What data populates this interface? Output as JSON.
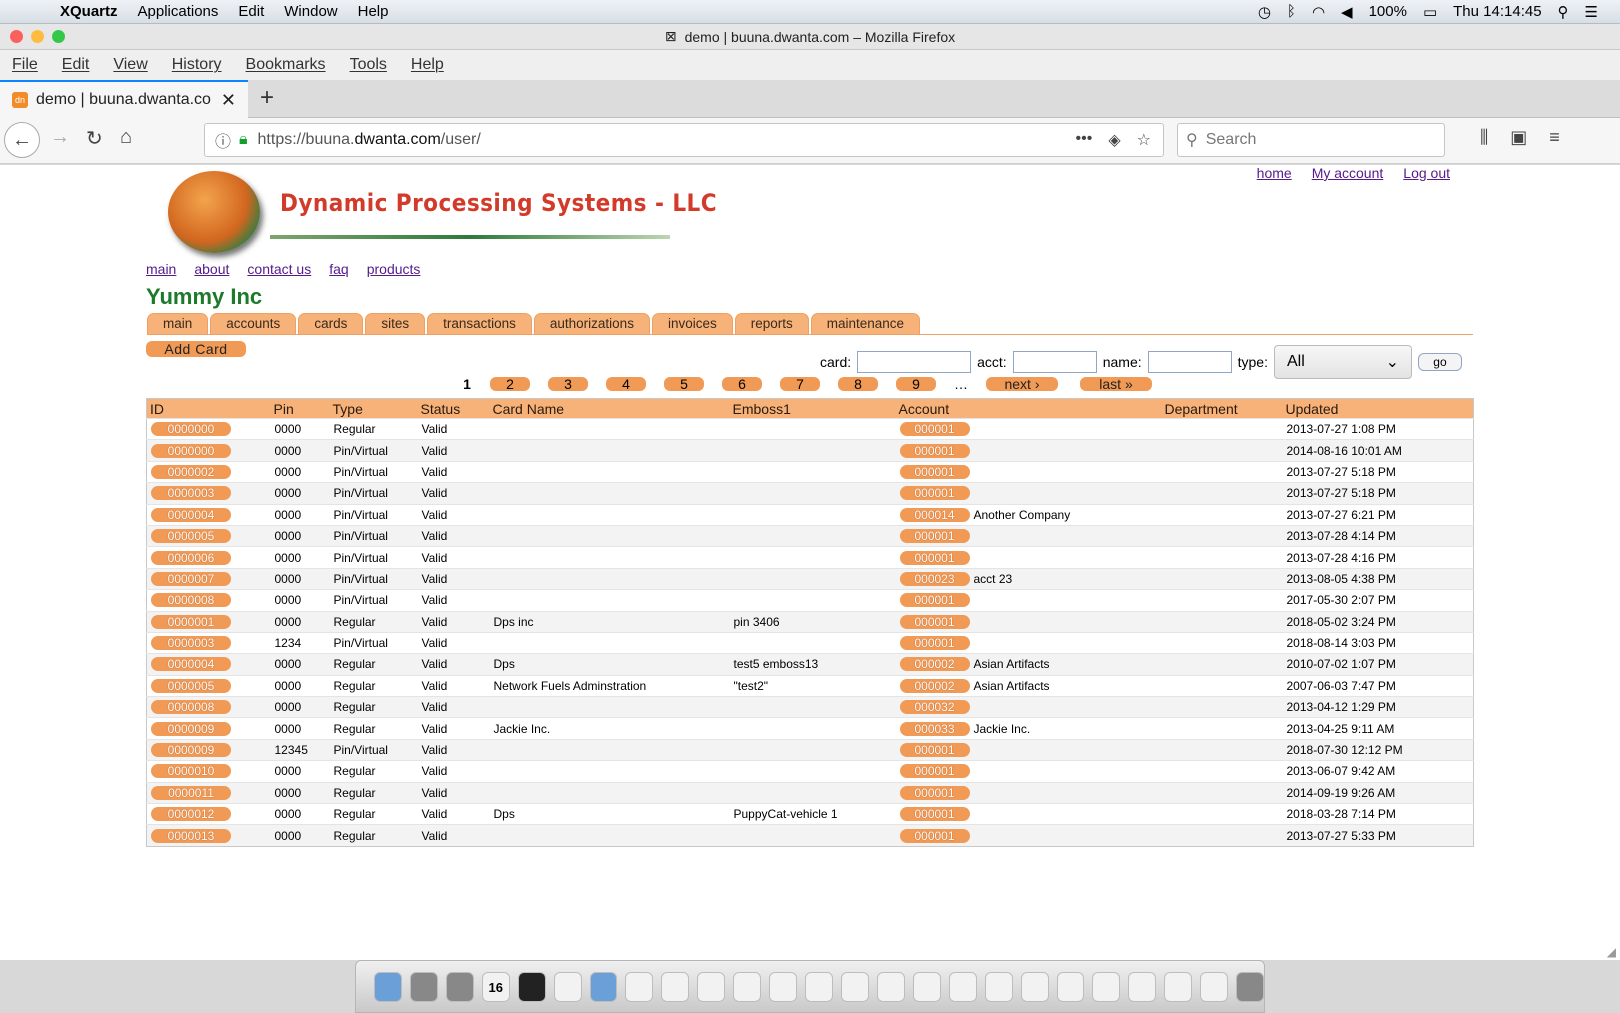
{
  "macmenu": {
    "app": "XQuartz",
    "items": [
      "Applications",
      "Edit",
      "Window",
      "Help"
    ],
    "battery": "100%",
    "clock": "Thu 14:14:45"
  },
  "window": {
    "title": "demo | buuna.dwanta.com – Mozilla Firefox"
  },
  "ffmenu": [
    "File",
    "Edit",
    "View",
    "History",
    "Bookmarks",
    "Tools",
    "Help"
  ],
  "tab": {
    "label": "demo | buuna.dwanta.co"
  },
  "url": {
    "prefix": "https://buuna.",
    "domain": "dwanta.com",
    "path": "/user/"
  },
  "search": {
    "placeholder": "Search"
  },
  "toplinks": {
    "home": "home",
    "account": "My account",
    "logout": "Log out"
  },
  "logo": {
    "text": "Dynamic Processing Systems - LLC"
  },
  "sitenav": [
    "main",
    "about",
    "contact us",
    "faq",
    "products"
  ],
  "company": "Yummy Inc",
  "tabs": [
    "main",
    "accounts",
    "cards",
    "sites",
    "transactions",
    "authorizations",
    "invoices",
    "reports",
    "maintenance"
  ],
  "add_card": "Add Card",
  "filters": {
    "card": "card:",
    "acct": "acct:",
    "name": "name:",
    "type": "type:",
    "type_value": "All",
    "go": "go"
  },
  "pager": {
    "current": "1",
    "pages": [
      "2",
      "3",
      "4",
      "5",
      "6",
      "7",
      "8",
      "9"
    ],
    "dots": "…",
    "next": "next ›",
    "last": "last »"
  },
  "columns": [
    "ID",
    "Pin",
    "Type",
    "Status",
    "Card Name",
    "Emboss1",
    "Account",
    "Department",
    "Updated"
  ],
  "rows": [
    {
      "id": "0000000",
      "pin": "0000",
      "type": "Regular",
      "status": "Valid",
      "name": "",
      "emboss": "",
      "account": "000001",
      "acctname": "",
      "dept": "",
      "updated": "2013-07-27 1:08 PM"
    },
    {
      "id": "0000000",
      "pin": "0000",
      "type": "Pin/Virtual",
      "status": "Valid",
      "name": "",
      "emboss": "",
      "account": "000001",
      "acctname": "",
      "dept": "",
      "updated": "2014-08-16 10:01 AM"
    },
    {
      "id": "0000002",
      "pin": "0000",
      "type": "Pin/Virtual",
      "status": "Valid",
      "name": "",
      "emboss": "",
      "account": "000001",
      "acctname": "",
      "dept": "",
      "updated": "2013-07-27 5:18 PM"
    },
    {
      "id": "0000003",
      "pin": "0000",
      "type": "Pin/Virtual",
      "status": "Valid",
      "name": "",
      "emboss": "",
      "account": "000001",
      "acctname": "",
      "dept": "",
      "updated": "2013-07-27 5:18 PM"
    },
    {
      "id": "0000004",
      "pin": "0000",
      "type": "Pin/Virtual",
      "status": "Valid",
      "name": "",
      "emboss": "",
      "account": "000014",
      "acctname": "Another Company",
      "dept": "",
      "updated": "2013-07-27 6:21 PM"
    },
    {
      "id": "0000005",
      "pin": "0000",
      "type": "Pin/Virtual",
      "status": "Valid",
      "name": "",
      "emboss": "",
      "account": "000001",
      "acctname": "",
      "dept": "",
      "updated": "2013-07-28 4:14 PM"
    },
    {
      "id": "0000006",
      "pin": "0000",
      "type": "Pin/Virtual",
      "status": "Valid",
      "name": "",
      "emboss": "",
      "account": "000001",
      "acctname": "",
      "dept": "",
      "updated": "2013-07-28 4:16 PM"
    },
    {
      "id": "0000007",
      "pin": "0000",
      "type": "Pin/Virtual",
      "status": "Valid",
      "name": "",
      "emboss": "",
      "account": "000023",
      "acctname": "acct 23",
      "dept": "",
      "updated": "2013-08-05 4:38 PM"
    },
    {
      "id": "0000008",
      "pin": "0000",
      "type": "Pin/Virtual",
      "status": "Valid",
      "name": "",
      "emboss": "",
      "account": "000001",
      "acctname": "",
      "dept": "",
      "updated": "2017-05-30 2:07 PM"
    },
    {
      "id": "0000001",
      "pin": "0000",
      "type": "Regular",
      "status": "Valid",
      "name": "Dps inc",
      "emboss": "pin 3406",
      "account": "000001",
      "acctname": "",
      "dept": "",
      "updated": "2018-05-02 3:24 PM"
    },
    {
      "id": "0000003",
      "pin": "1234",
      "type": "Pin/Virtual",
      "status": "Valid",
      "name": "",
      "emboss": "",
      "account": "000001",
      "acctname": "",
      "dept": "",
      "updated": "2018-08-14 3:03 PM"
    },
    {
      "id": "0000004",
      "pin": "0000",
      "type": "Regular",
      "status": "Valid",
      "name": "Dps",
      "emboss": "test5 emboss13",
      "account": "000002",
      "acctname": "Asian Artifacts",
      "dept": "",
      "updated": "2010-07-02 1:07 PM"
    },
    {
      "id": "0000005",
      "pin": "0000",
      "type": "Regular",
      "status": "Valid",
      "name": "Network Fuels Adminstration",
      "emboss": "\"test2\"",
      "account": "000002",
      "acctname": "Asian Artifacts",
      "dept": "",
      "updated": "2007-06-03 7:47 PM"
    },
    {
      "id": "0000008",
      "pin": "0000",
      "type": "Regular",
      "status": "Valid",
      "name": "",
      "emboss": "",
      "account": "000032",
      "acctname": "",
      "dept": "",
      "updated": "2013-04-12 1:29 PM"
    },
    {
      "id": "0000009",
      "pin": "0000",
      "type": "Regular",
      "status": "Valid",
      "name": "Jackie Inc.",
      "emboss": "",
      "account": "000033",
      "acctname": "Jackie Inc.",
      "dept": "",
      "updated": "2013-04-25 9:11 AM"
    },
    {
      "id": "0000009",
      "pin": "12345",
      "type": "Pin/Virtual",
      "status": "Valid",
      "name": "",
      "emboss": "",
      "account": "000001",
      "acctname": "",
      "dept": "",
      "updated": "2018-07-30 12:12 PM"
    },
    {
      "id": "0000010",
      "pin": "0000",
      "type": "Regular",
      "status": "Valid",
      "name": "",
      "emboss": "",
      "account": "000001",
      "acctname": "",
      "dept": "",
      "updated": "2013-06-07 9:42 AM"
    },
    {
      "id": "0000011",
      "pin": "0000",
      "type": "Regular",
      "status": "Valid",
      "name": "",
      "emboss": "",
      "account": "000001",
      "acctname": "",
      "dept": "",
      "updated": "2014-09-19 9:26 AM"
    },
    {
      "id": "0000012",
      "pin": "0000",
      "type": "Regular",
      "status": "Valid",
      "name": "Dps",
      "emboss": "PuppyCat-vehicle 1",
      "account": "000001",
      "acctname": "",
      "dept": "",
      "updated": "2018-03-28 7:14 PM"
    },
    {
      "id": "0000013",
      "pin": "0000",
      "type": "Regular",
      "status": "Valid",
      "name": "",
      "emboss": "",
      "account": "000001",
      "acctname": "",
      "dept": "",
      "updated": "2013-07-27 5:33 PM"
    }
  ],
  "dock": {
    "calendar_day": "16"
  }
}
